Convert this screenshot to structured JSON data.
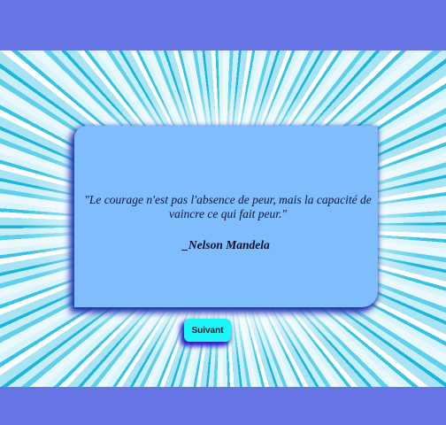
{
  "quote_card": {
    "quote": "\"Le courage n'est pas l'absence de peur, mais la capacité de vaincre ce qui fait peur.\"",
    "author": "_Nelson Mandela"
  },
  "actions": {
    "next_label": "Suivant"
  },
  "colors": {
    "page_background": "#6674e4",
    "card_background": "#80bdfd",
    "button_background": "#1ef7f7",
    "shadow": "#1b2fb0"
  }
}
